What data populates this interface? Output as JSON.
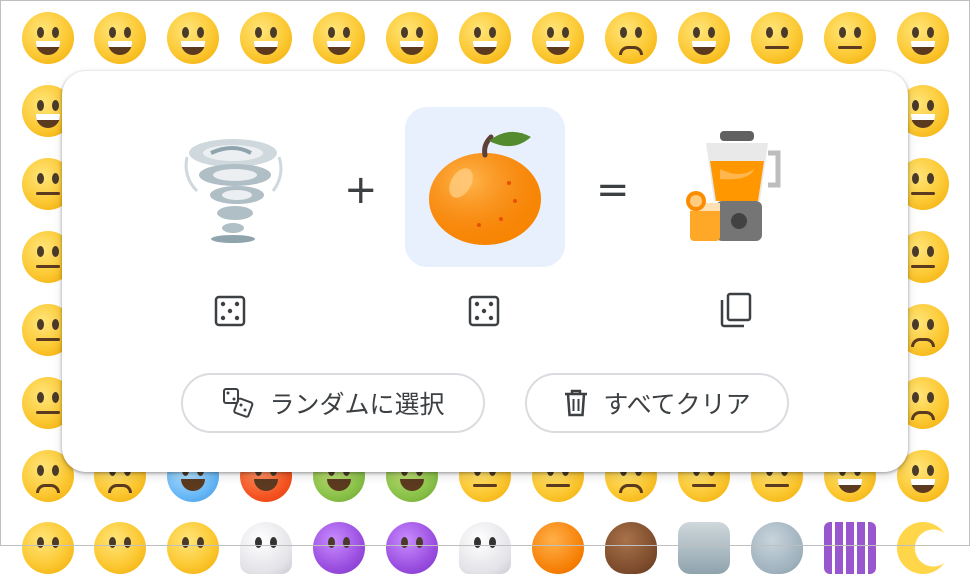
{
  "mixer": {
    "plus_sign": "+",
    "equals_sign": "=",
    "slots": [
      {
        "emoji": "tornado",
        "selected": false
      },
      {
        "emoji": "tangerine",
        "selected": true
      },
      {
        "emoji": "blender-with-orange-juice",
        "selected": false
      }
    ],
    "icons": [
      "dice-icon",
      "dice-icon",
      "copy-icon"
    ]
  },
  "actions": {
    "random_label": "ランダムに選択",
    "clear_label": "すべてクリア",
    "random_icon": "shuffle-dice-icon",
    "clear_icon": "trash-icon"
  },
  "colors": {
    "selected_slot_bg": "#e8f0fe",
    "text": "#3c4043",
    "pill_border": "#dadce0",
    "emoji_yellow": "#fcc934"
  }
}
